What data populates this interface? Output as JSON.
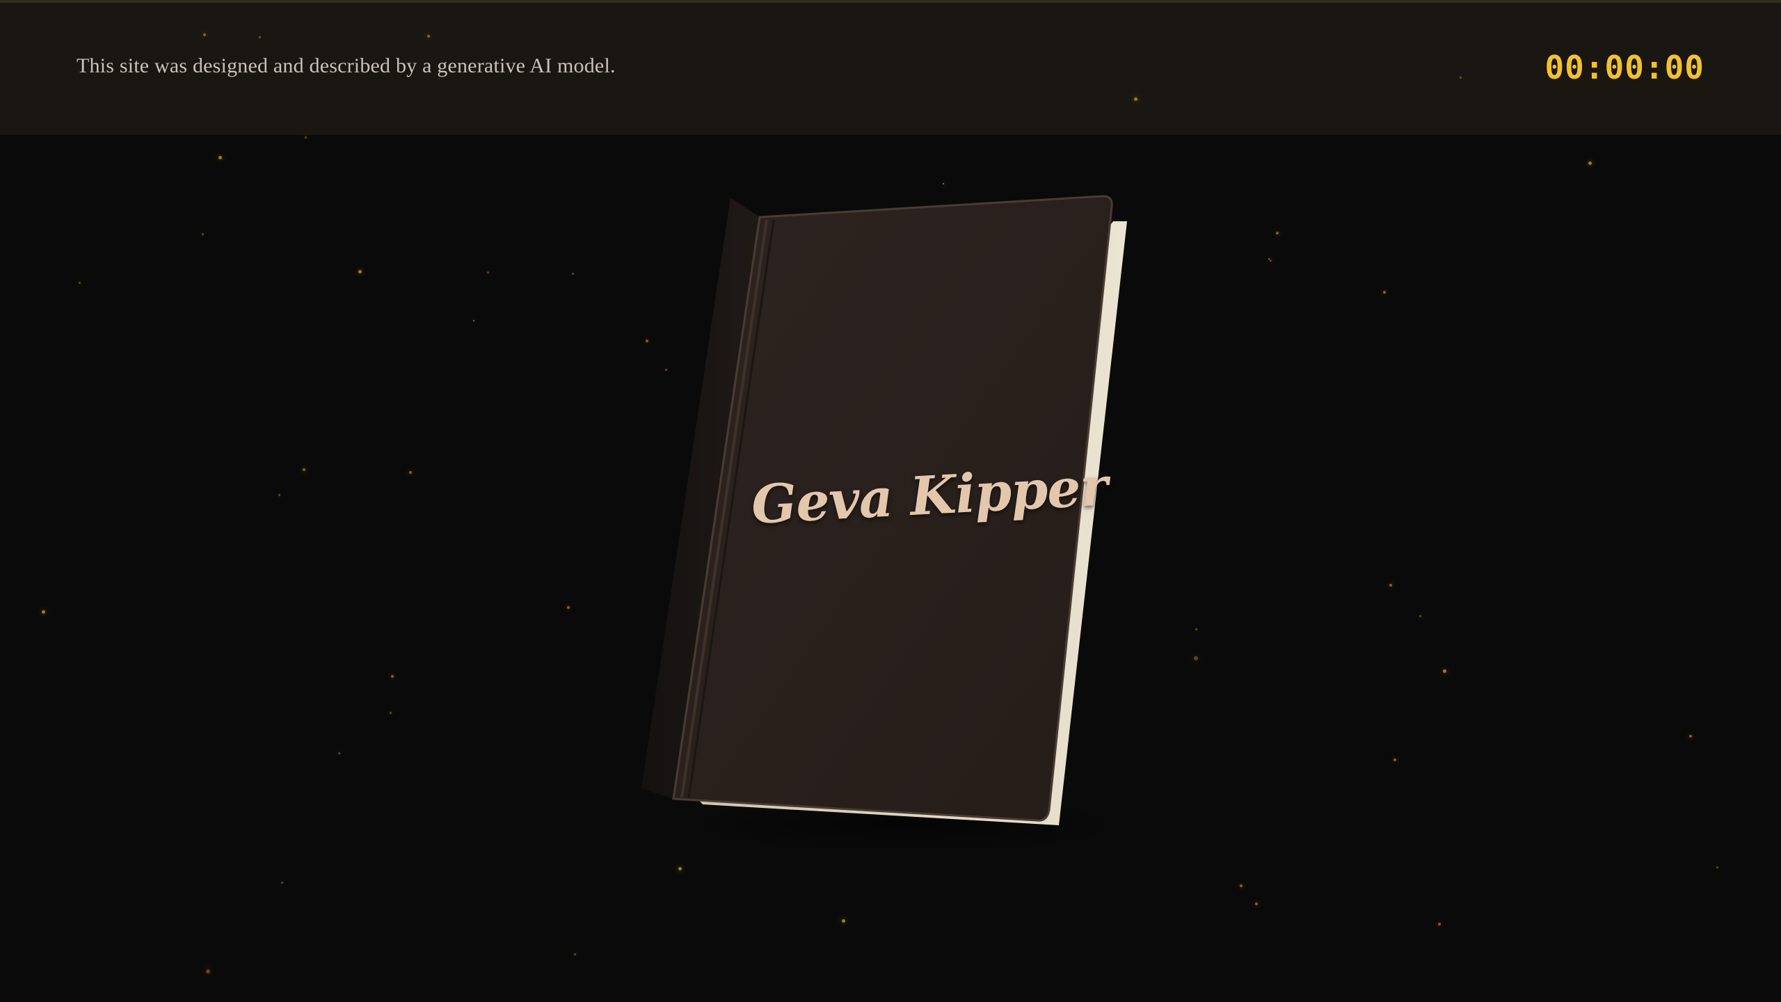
{
  "header": {
    "disclaimer": "This site was designed and described by a generative AI model.",
    "timer": "00:00:00"
  },
  "book": {
    "title": "Geva Kipper"
  },
  "colors": {
    "background": "#0a0a0a",
    "header_background": "#1a1612",
    "timer": "#f2c12e",
    "book_cover": "#2a1f1a",
    "book_title": "#e2c7ad",
    "pages": "#e8e0cc",
    "dust": "#b08a1e"
  }
}
